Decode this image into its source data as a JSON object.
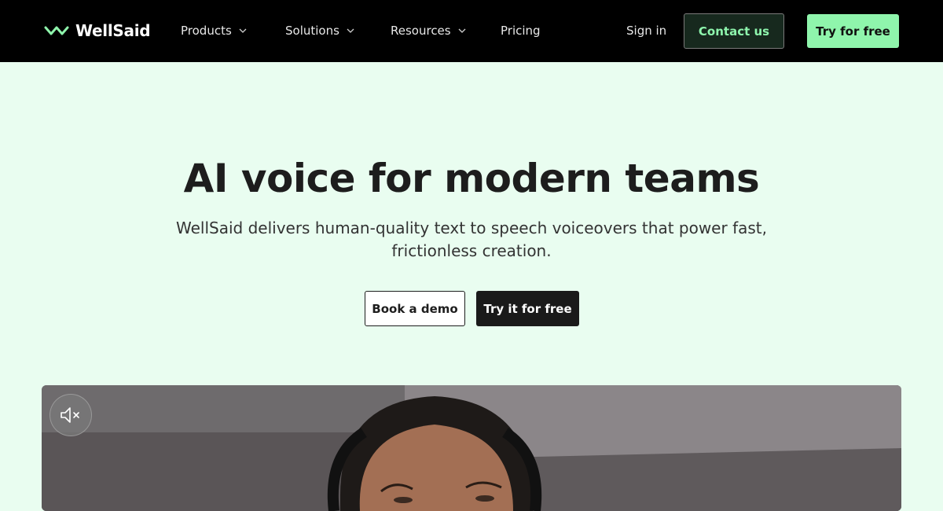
{
  "brand": {
    "name": "WellSaid",
    "accent": "#8ff5ac"
  },
  "nav": {
    "items": [
      {
        "label": "Products",
        "has_dropdown": true
      },
      {
        "label": "Solutions",
        "has_dropdown": true
      },
      {
        "label": "Resources",
        "has_dropdown": true
      },
      {
        "label": "Pricing",
        "has_dropdown": false
      }
    ],
    "sign_in": "Sign in",
    "contact": "Contact us",
    "try_free": "Try for free"
  },
  "hero": {
    "title": "AI voice for modern teams",
    "subtitle": "WellSaid delivers human-quality text to speech voiceovers that power fast, frictionless creation.",
    "demo_button": "Book a demo",
    "try_button": "Try it for free"
  },
  "video": {
    "mute_icon": "speaker-muted-icon"
  }
}
